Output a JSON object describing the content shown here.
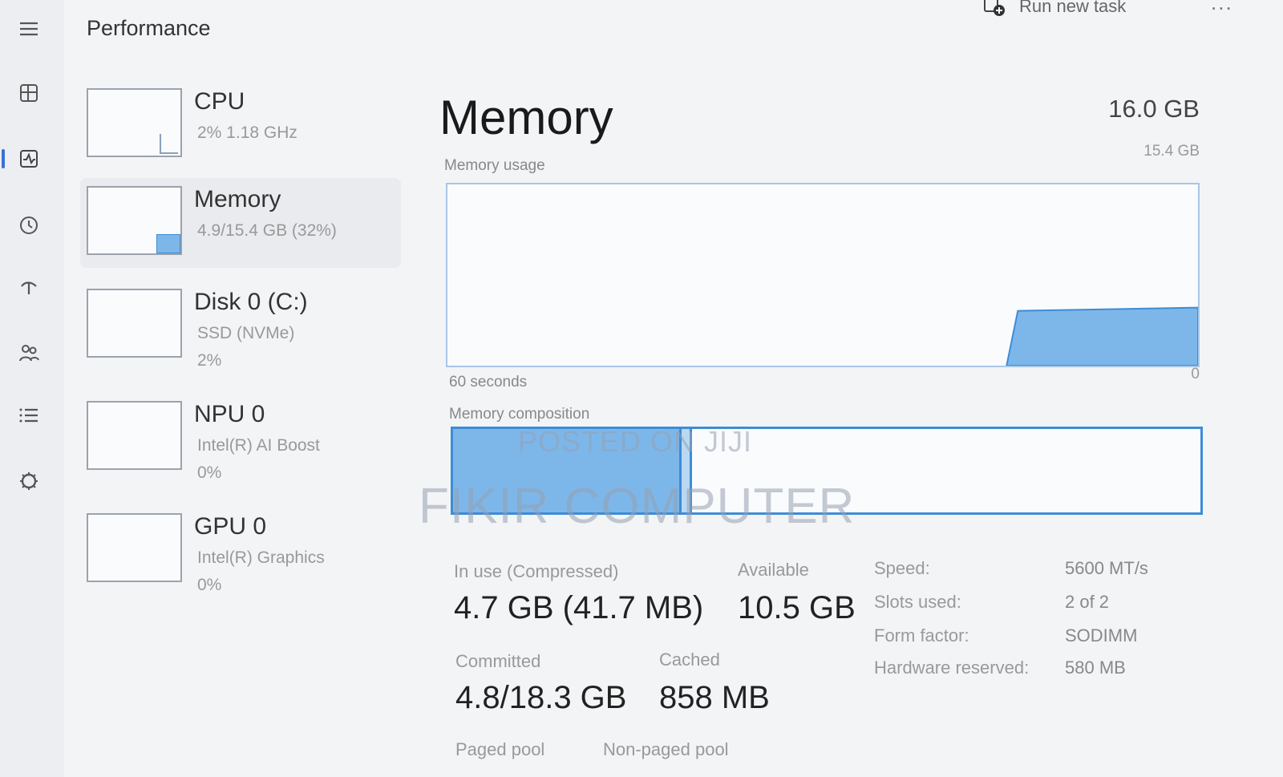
{
  "header": {
    "page_title": "Performance",
    "run_new_task_label": "Run new task",
    "more_label": "..."
  },
  "nav": {
    "items": [
      {
        "icon": "hamburger-menu-icon"
      },
      {
        "icon": "processes-icon"
      },
      {
        "icon": "performance-icon",
        "active": true
      },
      {
        "icon": "app-history-icon"
      },
      {
        "icon": "startup-apps-icon"
      },
      {
        "icon": "users-icon"
      },
      {
        "icon": "details-icon"
      },
      {
        "icon": "services-icon"
      }
    ]
  },
  "devices": [
    {
      "title": "CPU",
      "subtitle": "2% 1.18 GHz",
      "subtitle2": ""
    },
    {
      "title": "Memory",
      "subtitle": "4.9/15.4 GB (32%)",
      "subtitle2": "",
      "selected": true
    },
    {
      "title": "Disk 0 (C:)",
      "subtitle": "SSD (NVMe)",
      "subtitle2": "2%"
    },
    {
      "title": "NPU 0",
      "subtitle": "Intel(R) AI Boost",
      "subtitle2": "0%"
    },
    {
      "title": "GPU 0",
      "subtitle": "Intel(R) Graphics",
      "subtitle2": "0%"
    }
  ],
  "memory": {
    "heading": "Memory",
    "total": "16.0 GB",
    "usage_label": "Memory usage",
    "max_label": "15.4 GB",
    "time_label": "60 seconds",
    "zero_label": "0",
    "composition_label": "Memory composition",
    "graph_recent_usage_fraction": 0.32,
    "composition_in_use_fraction": 0.305,
    "composition_modified_fraction": 0.01
  },
  "stats": {
    "in_use_label": "In use (Compressed)",
    "in_use_value": "4.7 GB (41.7 MB)",
    "available_label": "Available",
    "available_value": "10.5 GB",
    "committed_label": "Committed",
    "committed_value": "4.8/18.3 GB",
    "cached_label": "Cached",
    "cached_value": "858 MB",
    "paged_pool_label": "Paged pool",
    "non_paged_pool_label": "Non-paged pool"
  },
  "specs": {
    "speed_label": "Speed:",
    "speed_value": "5600 MT/s",
    "slots_label": "Slots used:",
    "slots_value": "2 of 2",
    "form_label": "Form factor:",
    "form_value": "SODIMM",
    "reserved_label": "Hardware reserved:",
    "reserved_value": "580 MB"
  },
  "watermark": {
    "line1": "POSTED ON JIJI",
    "line2": "FIKIR COMPUTER"
  },
  "colors": {
    "accent": "#3d8cd6",
    "fill": "#7db7ea"
  }
}
